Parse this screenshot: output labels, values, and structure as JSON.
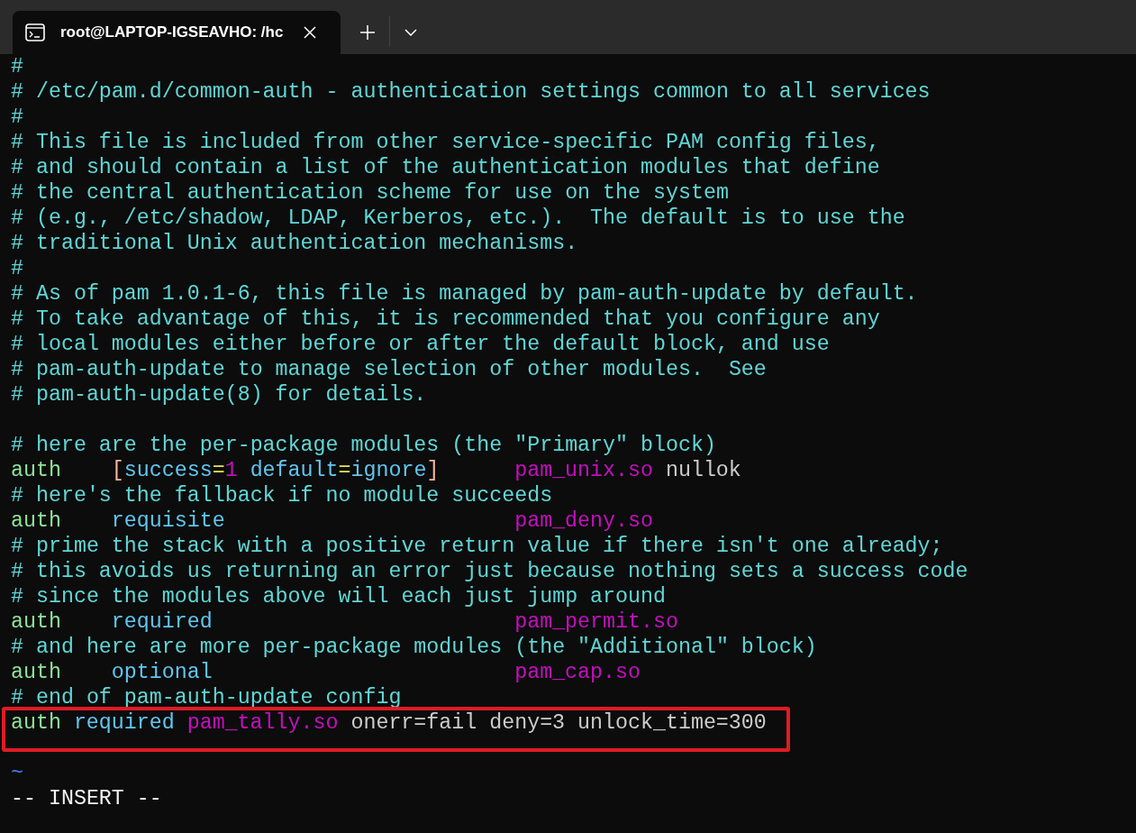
{
  "tabs": [
    {
      "title": "root@LAPTOP-IGSEAVHO: /hc",
      "selected": true
    }
  ],
  "editor": {
    "lines": [
      {
        "kind": "comment",
        "text": "#",
        "highlighted": false
      },
      {
        "kind": "comment",
        "text": "# /etc/pam.d/common-auth - authentication settings common to all services",
        "highlighted": false
      },
      {
        "kind": "comment",
        "text": "#",
        "highlighted": false
      },
      {
        "kind": "comment",
        "text": "# This file is included from other service-specific PAM config files,",
        "highlighted": false
      },
      {
        "kind": "comment",
        "text": "# and should contain a list of the authentication modules that define",
        "highlighted": false
      },
      {
        "kind": "comment",
        "text": "# the central authentication scheme for use on the system",
        "highlighted": false
      },
      {
        "kind": "comment",
        "text": "# (e.g., /etc/shadow, LDAP, Kerberos, etc.).  The default is to use the",
        "highlighted": false
      },
      {
        "kind": "comment",
        "text": "# traditional Unix authentication mechanisms.",
        "highlighted": false
      },
      {
        "kind": "comment",
        "text": "#",
        "highlighted": false
      },
      {
        "kind": "comment",
        "text": "# As of pam 1.0.1-6, this file is managed by pam-auth-update by default.",
        "highlighted": false
      },
      {
        "kind": "comment",
        "text": "# To take advantage of this, it is recommended that you configure any",
        "highlighted": false
      },
      {
        "kind": "comment",
        "text": "# local modules either before or after the default block, and use",
        "highlighted": false
      },
      {
        "kind": "comment",
        "text": "# pam-auth-update to manage selection of other modules.  See",
        "highlighted": false
      },
      {
        "kind": "comment",
        "text": "# pam-auth-update(8) for details.",
        "highlighted": false
      },
      {
        "kind": "blank",
        "highlighted": false
      },
      {
        "kind": "comment",
        "text": "# here are the per-package modules (the \"Primary\" block)",
        "highlighted": false
      },
      {
        "kind": "directive",
        "type": "auth",
        "control": [
          {
            "text": "[",
            "kind": "bracket"
          },
          {
            "text": "success",
            "kind": "control"
          },
          {
            "text": "=",
            "kind": "equals"
          },
          {
            "text": "1",
            "kind": "number"
          },
          {
            "text": " default",
            "kind": "control"
          },
          {
            "text": "=",
            "kind": "equals"
          },
          {
            "text": "ignore",
            "kind": "control"
          },
          {
            "text": "]",
            "kind": "bracket"
          }
        ],
        "module": "pam_unix.so",
        "args": "nullok",
        "highlighted": false
      },
      {
        "kind": "comment",
        "text": "# here's the fallback if no module succeeds",
        "highlighted": false
      },
      {
        "kind": "directive",
        "type": "auth",
        "control": [
          {
            "text": "requisite",
            "kind": "control"
          }
        ],
        "module": "pam_deny.so",
        "highlighted": false
      },
      {
        "kind": "comment",
        "text": "# prime the stack with a positive return value if there isn't one already;",
        "highlighted": false
      },
      {
        "kind": "comment",
        "text": "# this avoids us returning an error just because nothing sets a success code",
        "highlighted": false
      },
      {
        "kind": "comment",
        "text": "# since the modules above will each just jump around",
        "highlighted": false
      },
      {
        "kind": "directive",
        "type": "auth",
        "control": [
          {
            "text": "required",
            "kind": "control"
          }
        ],
        "module": "pam_permit.so",
        "highlighted": false
      },
      {
        "kind": "comment",
        "text": "# and here are more per-package modules (the \"Additional\" block)",
        "highlighted": false
      },
      {
        "kind": "directive",
        "type": "auth",
        "control": [
          {
            "text": "optional",
            "kind": "control"
          }
        ],
        "module": "pam_cap.so",
        "highlighted": false
      },
      {
        "kind": "comment",
        "text": "# end of pam-auth-update config",
        "highlighted": false
      },
      {
        "kind": "inline",
        "tokens": [
          {
            "text": "auth",
            "kind": "type"
          },
          {
            "text": "required",
            "kind": "control"
          },
          {
            "text": "pam_tally.so",
            "kind": "module"
          },
          {
            "text": "onerr=fail deny=3 unlock_time=300",
            "kind": "arg"
          }
        ],
        "highlighted": true
      },
      {
        "kind": "blank",
        "highlighted": false
      },
      {
        "kind": "tilde",
        "text": "~",
        "highlighted": false
      }
    ],
    "mode": "-- INSERT --"
  }
}
